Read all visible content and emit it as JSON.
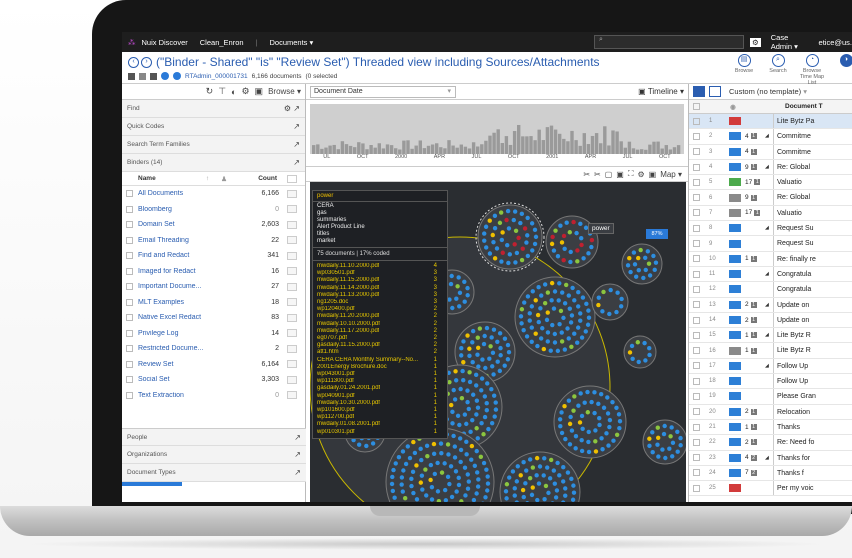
{
  "topbar": {
    "app_name": "Nuix Discover",
    "case_name": "Clean_Enron",
    "section": "Documents",
    "user_menu": "Case Admin",
    "user_email": "etice@us."
  },
  "header": {
    "search_title": "(\"Binder - Shared\" \"is\" \"Review Set\") Threaded view including Sources/Attachments",
    "rt_admin": "RTAdmin_000001731",
    "doc_count": "6,166 documents",
    "selected": "(0 selected",
    "actions": [
      "Browse",
      "Search",
      "Browse Time Map List"
    ]
  },
  "left": {
    "browse_label": "Browse",
    "find_label": "Find",
    "quick_codes": "Quick Codes",
    "search_term_families": "Search Term Families",
    "binders_header": "Binders (14)",
    "col_name": "Name",
    "col_count": "Count",
    "binders": [
      {
        "name": "All Documents",
        "count": "6,166"
      },
      {
        "name": "Bloomberg",
        "count": "0"
      },
      {
        "name": "Domain Set",
        "count": "2,603"
      },
      {
        "name": "Email Threading",
        "count": "22"
      },
      {
        "name": "Find and Redact",
        "count": "341"
      },
      {
        "name": "Imaged for Redact",
        "count": "16"
      },
      {
        "name": "Important Docume...",
        "count": "27"
      },
      {
        "name": "MLT Examples",
        "count": "18"
      },
      {
        "name": "Native Excel Redact",
        "count": "83"
      },
      {
        "name": "Privilege Log",
        "count": "14"
      },
      {
        "name": "Restricted Docume...",
        "count": "2"
      },
      {
        "name": "Review Set",
        "count": "6,164"
      },
      {
        "name": "Social Set",
        "count": "3,303"
      },
      {
        "name": "Text Extraction",
        "count": "0"
      }
    ],
    "bottom_sections": [
      "People",
      "Organizations",
      "Document Types"
    ]
  },
  "middle": {
    "date_field": "Document Date",
    "timeline_label": "Timeline",
    "map_label": "Map",
    "timeline_ticks": [
      "UL",
      "OCT",
      "2000",
      "APR",
      "JUL",
      "OCT",
      "2001",
      "APR",
      "JUL",
      "OCT"
    ],
    "map": {
      "tooltip": "power",
      "percent": "87%",
      "legend_title": "power",
      "keywords": [
        "CERA",
        "gas",
        "summaries",
        "Alert Product Line",
        "titles",
        "market"
      ],
      "coded_summary": "75 documents | 17% coded",
      "files": [
        {
          "name": "mwdaily.11.10.2000.pdf",
          "n": "4"
        },
        {
          "name": "wp030501.pdf",
          "n": "3"
        },
        {
          "name": "mwdaily.11.15.2000.pdf",
          "n": "3"
        },
        {
          "name": "mwdaily.11.14.2000.pdf",
          "n": "3"
        },
        {
          "name": "mwdaily.11.13.2000.pdf",
          "n": "3"
        },
        {
          "name": "ng1205.doc",
          "n": "3"
        },
        {
          "name": "wp120400.pdf",
          "n": "2"
        },
        {
          "name": "mwdaily.11.20.2000.pdf",
          "n": "2"
        },
        {
          "name": "mwdaily.10.10.2000.pdf",
          "n": "2"
        },
        {
          "name": "mwdaily.11.17.2000.pdf",
          "n": "2"
        },
        {
          "name": "eg0707.pdf",
          "n": "2"
        },
        {
          "name": "gasdaily.11.15.2000.pdf",
          "n": "2"
        },
        {
          "name": "att1.htm",
          "n": "2"
        },
        {
          "name": "CERA CERA Monthly Summary--No...",
          "n": "1"
        },
        {
          "name": "2001Energy Brochure.doc",
          "n": "1"
        },
        {
          "name": "wp043001.pdf",
          "n": "1"
        },
        {
          "name": "wp111300.pdf",
          "n": "1"
        },
        {
          "name": "gasdaily.01.24.2001.pdf",
          "n": "1"
        },
        {
          "name": "wp040901.pdf",
          "n": "1"
        },
        {
          "name": "mwdaily.10.30.2000.pdf",
          "n": "1"
        },
        {
          "name": "wp101600.pdf",
          "n": "1"
        },
        {
          "name": "wp112700.pdf",
          "n": "1"
        },
        {
          "name": "mwdaily.01.08.2001.pdf",
          "n": "1"
        },
        {
          "name": "wp010301.pdf",
          "n": "1"
        }
      ]
    }
  },
  "right": {
    "template": "Custom (no template)",
    "col_title": "Document T",
    "rows": [
      {
        "no": "1",
        "env": "red",
        "cnt": "",
        "badge": "",
        "arrow": "",
        "title": "Lite Bytz Pa",
        "sel": true
      },
      {
        "no": "2",
        "env": "blue",
        "cnt": "4",
        "badge": "1",
        "arrow": "◢",
        "title": "Commitme"
      },
      {
        "no": "3",
        "env": "blue",
        "cnt": "4",
        "badge": "1",
        "arrow": "",
        "title": "Commitme"
      },
      {
        "no": "4",
        "env": "blue",
        "cnt": "9",
        "badge": "1",
        "arrow": "◢",
        "title": "Re: Global"
      },
      {
        "no": "5",
        "env": "green",
        "cnt": "17",
        "badge": "1",
        "arrow": "",
        "title": "Valuatio"
      },
      {
        "no": "6",
        "env": "gray",
        "cnt": "9",
        "badge": "1",
        "arrow": "",
        "title": "Re: Global"
      },
      {
        "no": "7",
        "env": "gray",
        "cnt": "17",
        "badge": "1",
        "arrow": "",
        "title": "Valuatio"
      },
      {
        "no": "8",
        "env": "blue",
        "cnt": "",
        "badge": "",
        "arrow": "◢",
        "title": "Request Su"
      },
      {
        "no": "9",
        "env": "blue",
        "cnt": "",
        "badge": "",
        "arrow": "",
        "title": "Request Su"
      },
      {
        "no": "10",
        "env": "blue",
        "cnt": "1",
        "badge": "1",
        "arrow": "",
        "title": "Re: finally re"
      },
      {
        "no": "11",
        "env": "blue",
        "cnt": "",
        "badge": "",
        "arrow": "◢",
        "title": "Congratula"
      },
      {
        "no": "12",
        "env": "blue",
        "cnt": "",
        "badge": "",
        "arrow": "",
        "title": "Congratula"
      },
      {
        "no": "13",
        "env": "blue",
        "cnt": "2",
        "badge": "1",
        "arrow": "◢",
        "title": "Update on"
      },
      {
        "no": "14",
        "env": "blue",
        "cnt": "2",
        "badge": "1",
        "arrow": "",
        "title": "Update on"
      },
      {
        "no": "15",
        "env": "blue",
        "cnt": "1",
        "badge": "1",
        "arrow": "◢",
        "title": "Lite Bytz R"
      },
      {
        "no": "16",
        "env": "gray",
        "cnt": "1",
        "badge": "1",
        "arrow": "",
        "title": "Lite Bytz R"
      },
      {
        "no": "17",
        "env": "blue",
        "cnt": "",
        "badge": "",
        "arrow": "◢",
        "title": "Follow Up"
      },
      {
        "no": "18",
        "env": "blue",
        "cnt": "",
        "badge": "",
        "arrow": "",
        "title": "Follow Up"
      },
      {
        "no": "19",
        "env": "blue",
        "cnt": "",
        "badge": "",
        "arrow": "",
        "title": "Please Gran"
      },
      {
        "no": "20",
        "env": "blue",
        "cnt": "2",
        "badge": "1",
        "arrow": "",
        "title": "Relocation"
      },
      {
        "no": "21",
        "env": "blue",
        "cnt": "1",
        "badge": "1",
        "arrow": "",
        "title": "Thanks"
      },
      {
        "no": "22",
        "env": "blue",
        "cnt": "2",
        "badge": "1",
        "arrow": "",
        "title": "Re: Need fo"
      },
      {
        "no": "23",
        "env": "blue",
        "cnt": "4",
        "badge": "2",
        "arrow": "◢",
        "title": "Thanks for"
      },
      {
        "no": "24",
        "env": "blue",
        "cnt": "7",
        "badge": "2",
        "arrow": "",
        "title": "Thanks f"
      },
      {
        "no": "25",
        "env": "red",
        "cnt": "",
        "badge": "",
        "arrow": "",
        "title": "Per my voic"
      }
    ]
  },
  "colors": {
    "accent": "#2a5db0",
    "dot_blue": "#2d8ee0",
    "dot_red": "#c02030",
    "dot_green": "#8cc63f",
    "dot_yellow": "#f0c000",
    "map_bg": "#2a2d31"
  }
}
